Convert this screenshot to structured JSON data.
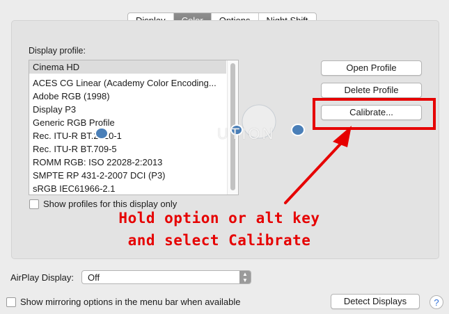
{
  "tabs": [
    {
      "label": "Display",
      "active": false
    },
    {
      "label": "Color",
      "active": true
    },
    {
      "label": "Options",
      "active": false
    },
    {
      "label": "Night Shift",
      "active": false
    }
  ],
  "profile_section": {
    "label": "Display profile:",
    "items": [
      "Cinema HD",
      "ACES CG Linear (Academy Color Encoding...",
      "Adobe RGB (1998)",
      "Display P3",
      "Generic RGB Profile",
      "Rec. ITU-R BT.2020-1",
      "Rec. ITU-R BT.709-5",
      "ROMM RGB: ISO 22028-2:2013",
      "SMPTE RP 431-2-2007 DCI (P3)",
      "sRGB IEC61966-2.1"
    ],
    "selected": "Cinema HD",
    "show_profiles_checkbox": "Show profiles for this display only"
  },
  "buttons": {
    "open_profile": "Open Profile",
    "delete_profile": "Delete Profile",
    "calibrate": "Calibrate..."
  },
  "annotation": {
    "line1": "Hold option or alt key",
    "line2": "and select Calibrate",
    "color": "#e60000"
  },
  "watermark": {
    "text": "UTION"
  },
  "airplay": {
    "label": "AirPlay Display:",
    "value": "Off"
  },
  "mirroring_checkbox": "Show mirroring options in the menu bar when available",
  "detect_displays": "Detect Displays",
  "help": "?"
}
